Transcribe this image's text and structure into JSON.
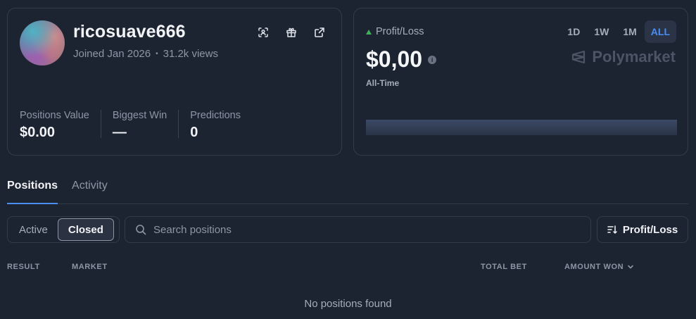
{
  "profile": {
    "username": "ricosuave666",
    "joined": "Joined Jan 2026",
    "views": "31.2k views",
    "meta_separator": "•",
    "icons": [
      "scan-icon",
      "gift-icon",
      "external-link-icon"
    ],
    "stats": [
      {
        "label": "Positions Value",
        "value": "$0.00"
      },
      {
        "label": "Biggest Win",
        "value": "—"
      },
      {
        "label": "Predictions",
        "value": "0"
      }
    ]
  },
  "pnl": {
    "title": "Profit/Loss",
    "value": "$0,00",
    "info_glyph": "i",
    "period": "All-Time",
    "brand": "Polymarket",
    "ranges": [
      {
        "label": "1D",
        "active": false
      },
      {
        "label": "1W",
        "active": false
      },
      {
        "label": "1M",
        "active": false
      },
      {
        "label": "ALL",
        "active": true
      }
    ],
    "accent": "#4c8df0",
    "up_color": "#3fb15d"
  },
  "tabs": [
    {
      "label": "Positions",
      "active": true
    },
    {
      "label": "Activity",
      "active": false
    }
  ],
  "filter": {
    "options": [
      {
        "label": "Active",
        "active": false
      },
      {
        "label": "Closed",
        "active": true
      }
    ]
  },
  "search": {
    "placeholder": "Search positions",
    "value": ""
  },
  "sort": {
    "label": "Profit/Loss"
  },
  "table": {
    "columns": [
      "RESULT",
      "MARKET",
      "TOTAL BET",
      "AMOUNT WON"
    ],
    "empty_message": "No positions found"
  }
}
